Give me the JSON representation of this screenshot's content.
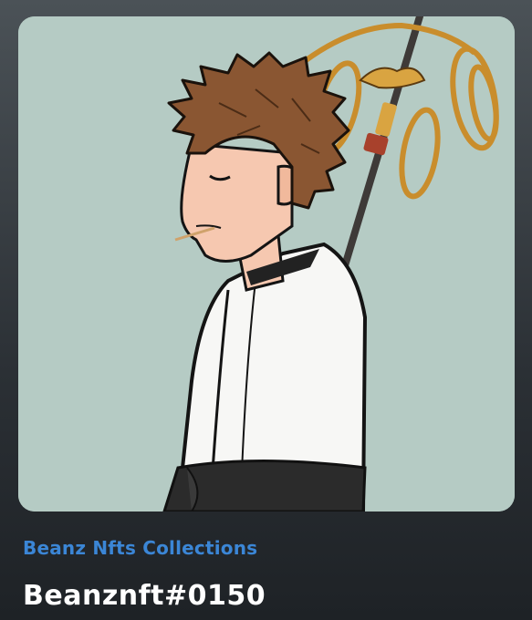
{
  "card": {
    "image_icon": "nft-artwork-image",
    "background_color": "#b5cbc4"
  },
  "meta": {
    "collection_name": "Beanz Nfts Collections",
    "token_name": "Beanznft#0150"
  },
  "colors": {
    "collection_link": "#3b86d6",
    "title_text": "#ffffff"
  }
}
